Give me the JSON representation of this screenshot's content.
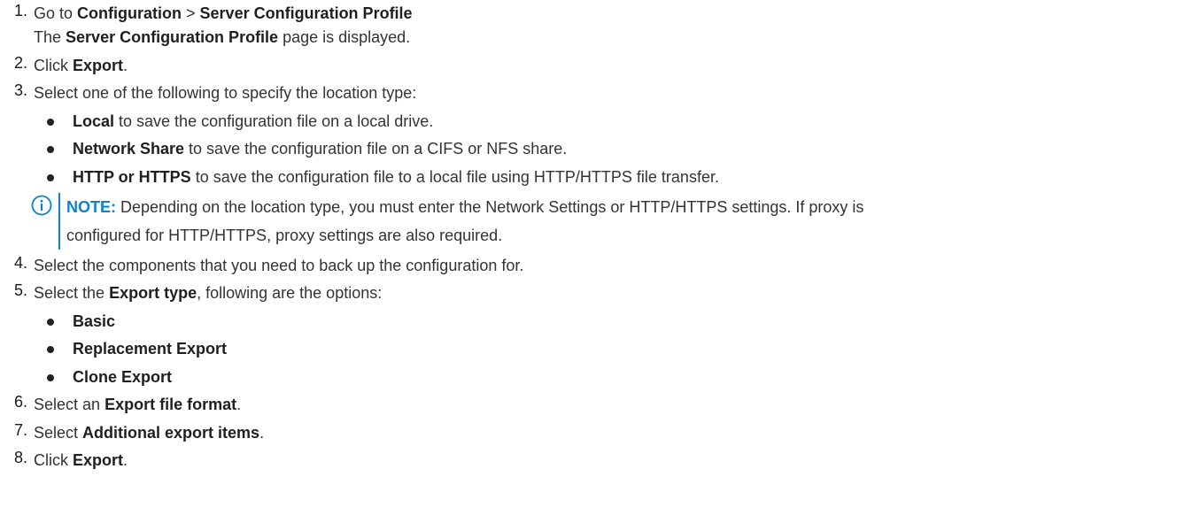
{
  "steps": [
    {
      "num": "1.",
      "pre": "Go to ",
      "b1": "Configuration",
      "mid": " > ",
      "b2": "Server Configuration Profile"
    },
    {
      "num": "2.",
      "pre": "Click ",
      "b": "Export",
      "post": "."
    },
    {
      "num": "3.",
      "text": "Select one of the following to specify the location type:"
    },
    {
      "num": "4.",
      "text": "Select the components that you need to back up the configuration for."
    },
    {
      "num": "5.",
      "pre": "Select the ",
      "b": "Export type",
      "post": ", following are the options:"
    },
    {
      "num": "6.",
      "pre": "Select an ",
      "b": "Export file format",
      "post": "."
    },
    {
      "num": "7.",
      "pre": "Select ",
      "b": "Additional export items",
      "post": "."
    },
    {
      "num": "8.",
      "pre": "Click ",
      "b": "Export",
      "post": "."
    }
  ],
  "step1_result": {
    "pre": "The ",
    "b": "Server Configuration Profile",
    "post": " page is displayed."
  },
  "location_options": [
    {
      "b": "Local",
      "post": " to save the configuration file on a local drive."
    },
    {
      "b": "Network Share",
      "post": " to save the configuration file on a CIFS or NFS share."
    },
    {
      "b": "HTTP or HTTPS",
      "post": " to save the configuration file to a local file using HTTP/HTTPS file transfer."
    }
  ],
  "note": {
    "label": "NOTE:",
    "line1": " Depending on the location type, you must enter the Network Settings or HTTP/HTTPS settings. If proxy is",
    "line2": "configured for HTTP/HTTPS, proxy settings are also required."
  },
  "export_types": [
    "Basic",
    "Replacement Export",
    "Clone Export"
  ],
  "colors": {
    "note_accent": "#0e82c8",
    "text": "#333333"
  },
  "icons": {
    "note": "info-circle-icon"
  }
}
